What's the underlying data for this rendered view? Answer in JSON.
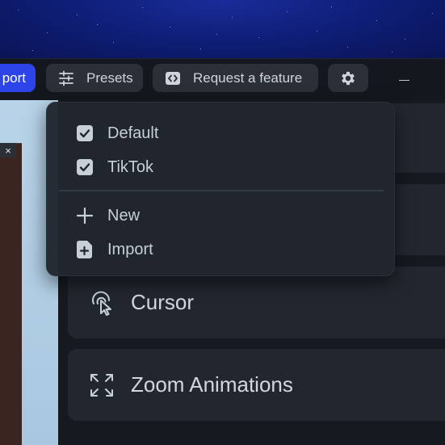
{
  "toolbar": {
    "export_label": "port",
    "presets_label": "Presets",
    "request_label": "Request a feature"
  },
  "presets_menu": {
    "items": [
      {
        "label": "Default",
        "icon": "checkbox-checked-icon"
      },
      {
        "label": "TikTok",
        "icon": "checkbox-checked-icon"
      },
      {
        "label": "New",
        "icon": "plus-icon"
      },
      {
        "label": "Import",
        "icon": "file-plus-icon"
      }
    ]
  },
  "sections": [
    {
      "label": "Cursor",
      "icon": "cursor-click-icon"
    },
    {
      "label": "Zoom Animations",
      "icon": "zoom-expand-icon"
    }
  ],
  "preview": {
    "close_glyph": "×"
  },
  "colors": {
    "accent": "#2d45e8",
    "toolbar_bg": "#14181e",
    "button_bg": "#2a2f38",
    "card_bg": "#22272f",
    "menu_bg": "#21262e"
  }
}
